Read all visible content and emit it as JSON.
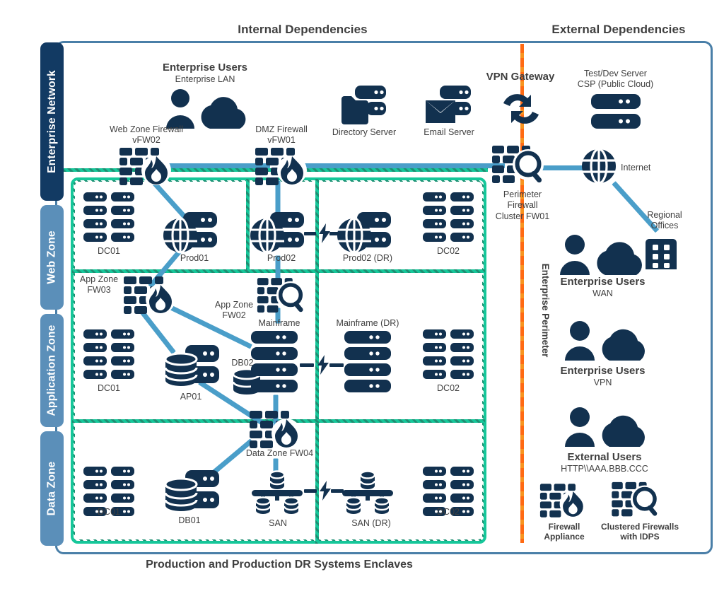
{
  "meta": {
    "colors": {
      "navy": "#12314f",
      "link_blue": "#4a9ec9",
      "frame_blue": "#4a7fa8",
      "tab_navy": "#123a63",
      "tab_blue": "#5b8fb9",
      "teal": "#16c79a",
      "teal_dark": "#1d8f72",
      "orange": "#ff6a13",
      "text": "#3f3f3f",
      "white": "#ffffff"
    }
  },
  "headers": {
    "internal": "Internal Dependencies",
    "external": "External Dependencies"
  },
  "caption": "Production and Production DR Systems Enclaves",
  "zone_tabs": [
    {
      "label": "Enterprise Network",
      "style": "navy"
    },
    {
      "label": "Web Zone",
      "style": "blue"
    },
    {
      "label": "Application Zone",
      "style": "blue"
    },
    {
      "label": "Data Zone",
      "style": "blue"
    }
  ],
  "perimeter_label": "Enterprise Perimeter",
  "nodes": {
    "enterprise_users_lan": {
      "title": "Enterprise Users",
      "sub": "Enterprise LAN",
      "icon": "user-cloud-icon"
    },
    "web_zone_firewall": {
      "title": "Web Zone Firewall",
      "sub": "vFW02",
      "icon": "firewall-icon"
    },
    "dmz_firewall": {
      "title": "DMZ Firewall",
      "sub": "vFW01",
      "icon": "firewall-icon"
    },
    "directory_server": {
      "title": "Directory Server",
      "sub": "",
      "icon": "directory-server-icon"
    },
    "email_server": {
      "title": "Email Server",
      "sub": "",
      "icon": "email-server-icon"
    },
    "vpn_gateway": {
      "title": "VPN Gateway",
      "sub": "",
      "icon": "vpn-exchange-icon"
    },
    "test_dev_server": {
      "title": "Test/Dev Server",
      "sub": "CSP (Public Cloud)",
      "icon": "server-stack-icon"
    },
    "perimeter_firewall": {
      "title": "Perimeter",
      "sub": "Firewall",
      "sub2": "Cluster FW01",
      "icon": "clustered-firewall-idps-icon"
    },
    "internet": {
      "title": "Internet",
      "sub": "",
      "icon": "globe-icon"
    },
    "regional_offices": {
      "title": "Regional",
      "sub": "Offices",
      "icon": "office-building-icon"
    },
    "enterprise_users_wan": {
      "title": "Enterprise Users",
      "sub": "WAN",
      "icon": "user-cloud-icon"
    },
    "enterprise_users_vpn": {
      "title": "Enterprise Users",
      "sub": "VPN",
      "icon": "user-cloud-icon"
    },
    "external_users": {
      "title": "External Users",
      "sub": "HTTP\\\\AAA.BBB.CCC",
      "icon": "user-cloud-icon"
    },
    "web_dc01": {
      "title": "DC01",
      "sub": "",
      "icon": "datacenter-rack-icon"
    },
    "prod01": {
      "title": "Prod01",
      "sub": "",
      "icon": "web-server-icon"
    },
    "prod02": {
      "title": "Prod02",
      "sub": "",
      "icon": "web-server-icon"
    },
    "prod02_dr": {
      "title": "Prod02 (DR)",
      "sub": "",
      "icon": "web-server-icon"
    },
    "web_dc02": {
      "title": "DC02",
      "sub": "",
      "icon": "datacenter-rack-icon"
    },
    "app_zone_fw03": {
      "title": "App Zone",
      "sub": "FW03",
      "icon": "firewall-icon"
    },
    "app_zone_fw02": {
      "title": "App Zone",
      "sub": "FW02",
      "icon": "clustered-firewall-idps-icon"
    },
    "app_dc01": {
      "title": "DC01",
      "sub": "",
      "icon": "datacenter-rack-icon"
    },
    "ap01": {
      "title": "AP01",
      "sub": "",
      "icon": "database-server-icon"
    },
    "db02": {
      "title": "DB02",
      "sub": "",
      "icon": "database-small-icon"
    },
    "mainframe": {
      "title": "Mainframe",
      "sub": "",
      "icon": "mainframe-icon"
    },
    "mainframe_dr": {
      "title": "Mainframe (DR)",
      "sub": "",
      "icon": "mainframe-icon"
    },
    "app_dc02": {
      "title": "DC02",
      "sub": "",
      "icon": "datacenter-rack-icon"
    },
    "data_zone_fw04": {
      "title": "Data Zone FW04",
      "sub": "",
      "icon": "firewall-icon"
    },
    "data_dc01": {
      "title": "DC01",
      "sub": "",
      "icon": "datacenter-rack-icon"
    },
    "db01": {
      "title": "DB01",
      "sub": "",
      "icon": "database-server-icon"
    },
    "san": {
      "title": "SAN",
      "sub": "",
      "icon": "san-icon"
    },
    "san_dr": {
      "title": "SAN (DR)",
      "sub": "",
      "icon": "san-icon"
    },
    "data_dc02": {
      "title": "DC02",
      "sub": "",
      "icon": "datacenter-rack-icon"
    }
  },
  "legend": [
    {
      "title": "Firewall",
      "sub": "Appliance",
      "icon": "firewall-icon"
    },
    {
      "title": "Clustered Firewalls",
      "sub": "with IDPS",
      "icon": "clustered-firewall-idps-icon"
    }
  ]
}
